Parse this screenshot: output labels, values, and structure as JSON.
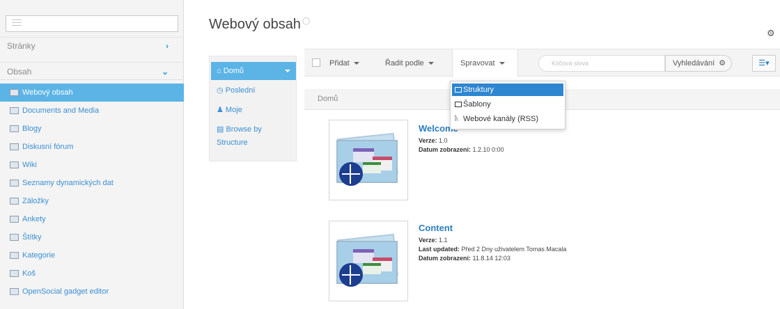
{
  "sidebar": {
    "sections": {
      "pages": "Stránky",
      "content": "Obsah"
    },
    "items": [
      {
        "label": "Webový obsah",
        "active": true
      },
      {
        "label": "Documents and Media"
      },
      {
        "label": "Blogy"
      },
      {
        "label": "Diskusní fórum"
      },
      {
        "label": "Wiki"
      },
      {
        "label": "Seznamy dynamických dat"
      },
      {
        "label": "Záložky"
      },
      {
        "label": "Ankety"
      },
      {
        "label": "Štítky"
      },
      {
        "label": "Kategorie"
      },
      {
        "label": "Koš"
      },
      {
        "label": "OpenSocial gadget editor"
      }
    ]
  },
  "header": {
    "title": "Webový obsah",
    "help_badge": "?"
  },
  "nav": {
    "active": "Domů",
    "links": [
      "Poslední",
      "Moje",
      "Browse by",
      "Structure"
    ]
  },
  "toolbar": {
    "add_label": "Přidat",
    "sort_label": "Řadit podle",
    "manage_label": "Spravovat",
    "search_placeholder": "Klíčová slova",
    "search_button": "Vyhledávání"
  },
  "breadcrumb": "Domů",
  "dropdown": {
    "items": [
      "Struktury",
      "Šablony",
      "Webové kanály (RSS)"
    ]
  },
  "articles": [
    {
      "title": "Welcome",
      "version_label": "Verze:",
      "version": "1.0",
      "display_label": "Datum zobrazení:",
      "display_date": "1.2.10 0:00"
    },
    {
      "title": "Content",
      "version_label": "Verze:",
      "version": "1.1",
      "updated_label": "Last updated:",
      "updated": "Před 2 Dny uživatelem Tomas Macala",
      "display_label": "Datum zobrazení:",
      "display_date": "11.8.14 12:03"
    }
  ],
  "colors": {
    "accent": "#5cb3e6",
    "link": "#3a8ed3",
    "menu_selected": "#2e86d0"
  }
}
